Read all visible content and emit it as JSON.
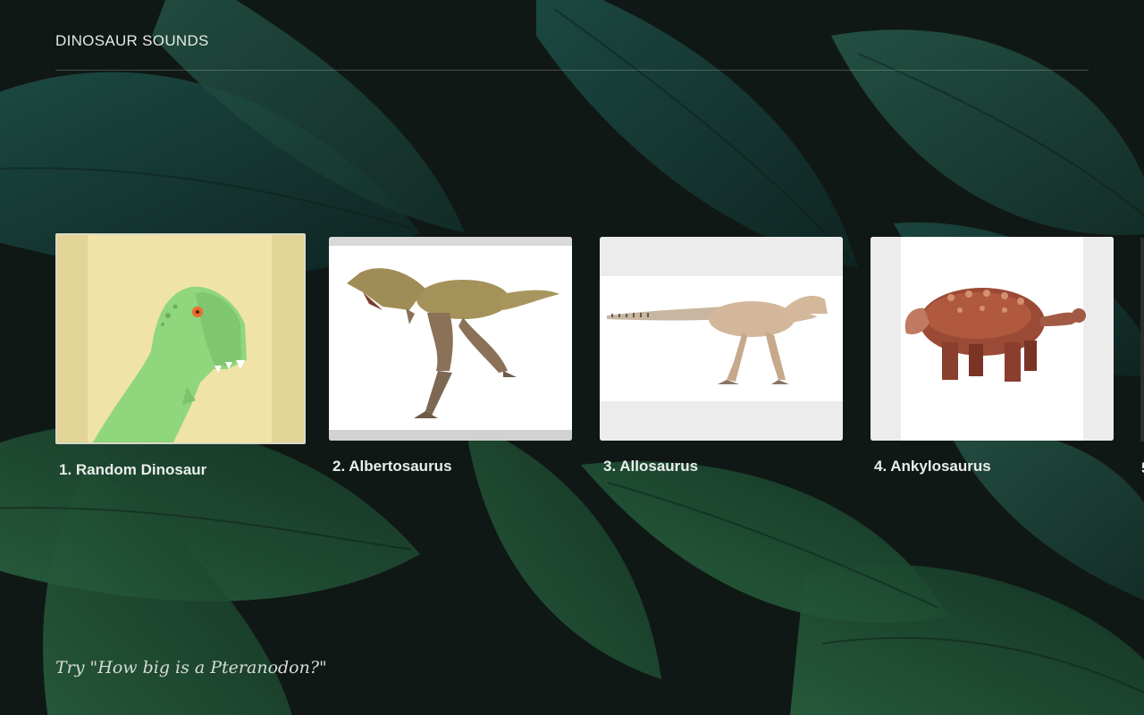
{
  "app": {
    "title": "DINOSAUR SOUNDS"
  },
  "cards": [
    {
      "label": "1. Random Dinosaur",
      "icon": "cartoon-trex",
      "selected": true
    },
    {
      "label": "2. Albertosaurus",
      "icon": "albertosaurus",
      "selected": false
    },
    {
      "label": "3. Allosaurus",
      "icon": "allosaurus",
      "selected": false
    },
    {
      "label": "4. Ankylosaurus",
      "icon": "ankylosaurus",
      "selected": false
    }
  ],
  "peek_label": "5",
  "hint": "Try \"How big is a Pteranodon?\"",
  "colors": {
    "background": "#0f1614",
    "leaf": "#1d4a3a",
    "selected_border": "#d2d7d2",
    "trex_bg": "#f0e3a7",
    "trex_green": "#8fd67c"
  }
}
